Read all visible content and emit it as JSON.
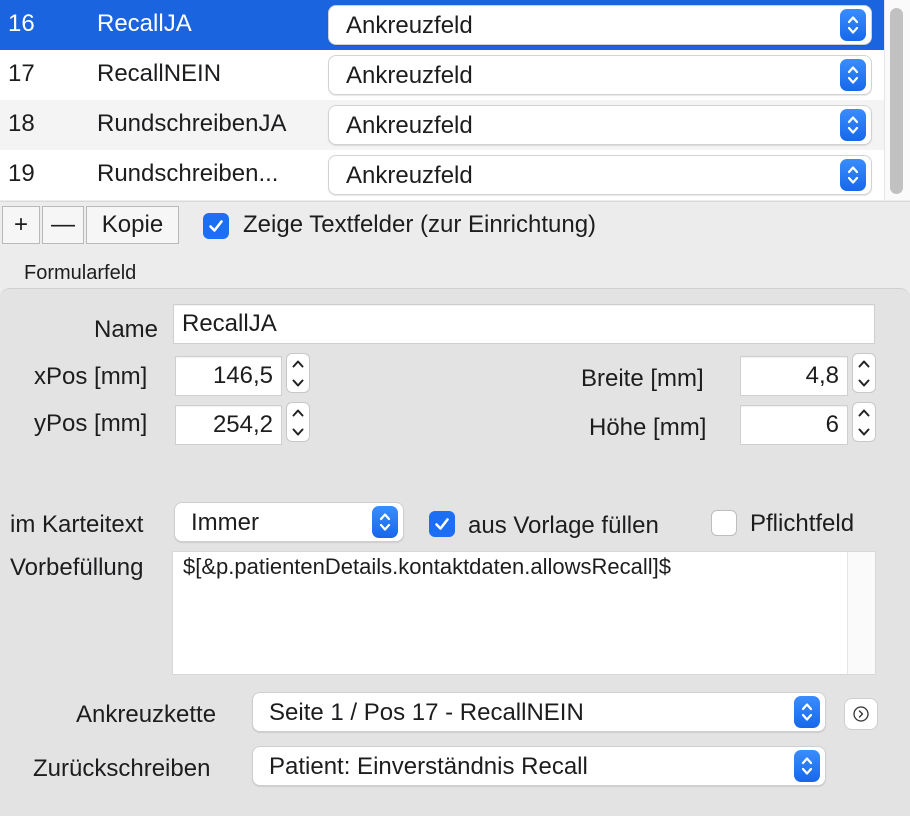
{
  "table": {
    "rows": [
      {
        "num": "16",
        "name": "RecallJA",
        "type": "Ankreuzfeld",
        "selected": true
      },
      {
        "num": "17",
        "name": "RecallNEIN",
        "type": "Ankreuzfeld",
        "selected": false
      },
      {
        "num": "18",
        "name": "RundschreibenJA",
        "type": "Ankreuzfeld",
        "selected": false
      },
      {
        "num": "19",
        "name": "Rundschreiben...",
        "type": "Ankreuzfeld",
        "selected": false
      }
    ]
  },
  "toolbar": {
    "add_label": "+",
    "remove_label": "—",
    "copy_label": "Kopie",
    "show_textfields_label": "Zeige Textfelder (zur Einrichtung)",
    "show_textfields_checked": true
  },
  "form": {
    "section_title": "Formularfeld",
    "name_label": "Name",
    "name_value": "RecallJA",
    "xpos_label": "xPos [mm]",
    "xpos_value": "146,5",
    "ypos_label": "yPos [mm]",
    "ypos_value": "254,2",
    "width_label": "Breite [mm]",
    "width_value": "4,8",
    "height_label": "Höhe [mm]",
    "height_value": "6",
    "karteitext_label": "im Karteitext",
    "karteitext_value": "Immer",
    "from_template_label": "aus Vorlage füllen",
    "from_template_checked": true,
    "required_label": "Pflichtfeld",
    "required_checked": false,
    "prefill_label": "Vorbefüllung",
    "prefill_value": "$[&p.patientenDetails.kontaktdaten.allowsRecall]$",
    "chain_label": "Ankreuzkette",
    "chain_value": "Seite 1 / Pos 17 - RecallNEIN",
    "writeback_label": "Zurückschreiben",
    "writeback_value": "Patient: Einverständnis Recall"
  },
  "colors": {
    "selection": "#1a64e0",
    "accent": "#1c6ef2",
    "panel": "#e3e3e3"
  },
  "icons": {
    "popup_arrows": "up-down-chevron-icon",
    "stepper": "stepper-chevrons-icon",
    "goto": "circle-arrow-right-icon",
    "check": "checkmark-icon"
  }
}
